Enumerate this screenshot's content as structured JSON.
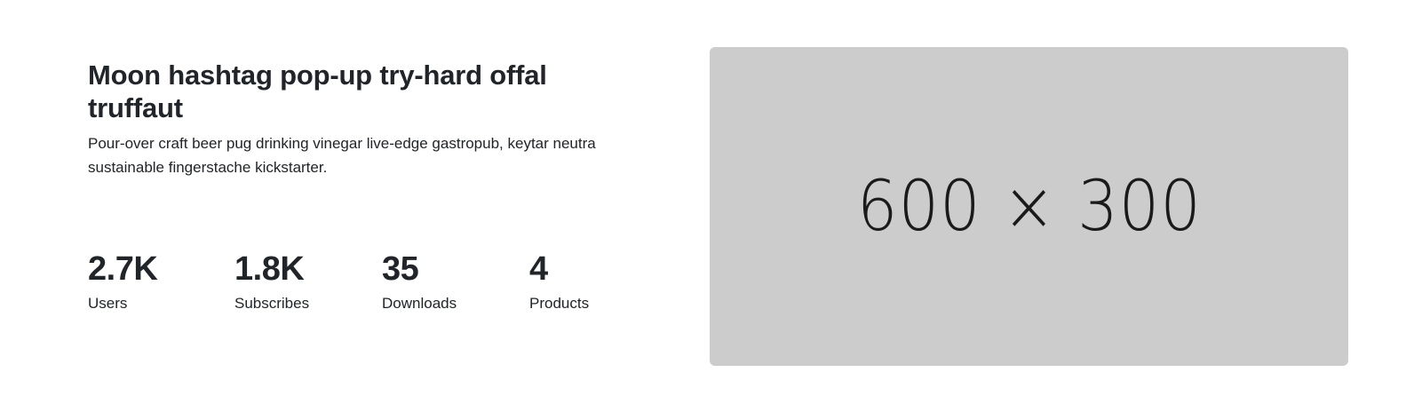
{
  "hero": {
    "title": "Moon hashtag pop-up try-hard offal truffaut",
    "description": "Pour-over craft beer pug drinking vinegar live-edge gastropub, keytar neutra sustainable fingerstache kickstarter."
  },
  "stats": [
    {
      "value": "2.7K",
      "label": "Users"
    },
    {
      "value": "1.8K",
      "label": "Subscribes"
    },
    {
      "value": "35",
      "label": "Downloads"
    },
    {
      "value": "4",
      "label": "Products"
    }
  ],
  "image_placeholder": {
    "text": "600 × 300",
    "background": "#cccccc"
  }
}
